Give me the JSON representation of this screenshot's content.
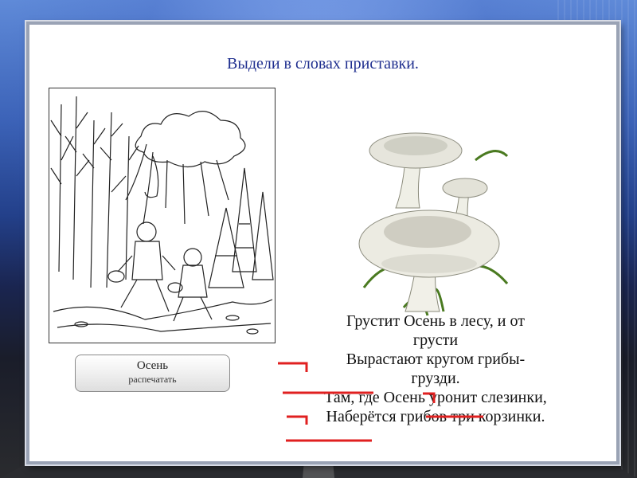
{
  "slide": {
    "title": "Выдели в словах приставки.",
    "button": {
      "label": "Осень",
      "sublabel": "распечатать"
    },
    "poem": [
      "Грустит Осень в лесу, и от",
      "грусти",
      "Вырастают кругом грибы-",
      "грузди.",
      "Там, где Осень уронит слезинки,",
      "Наберётся грибов три корзинки."
    ]
  },
  "colors": {
    "title": "#1f2f8f",
    "mark": "#e02020"
  },
  "icons": [
    "autumn-drawing",
    "mushroom-illustration"
  ]
}
